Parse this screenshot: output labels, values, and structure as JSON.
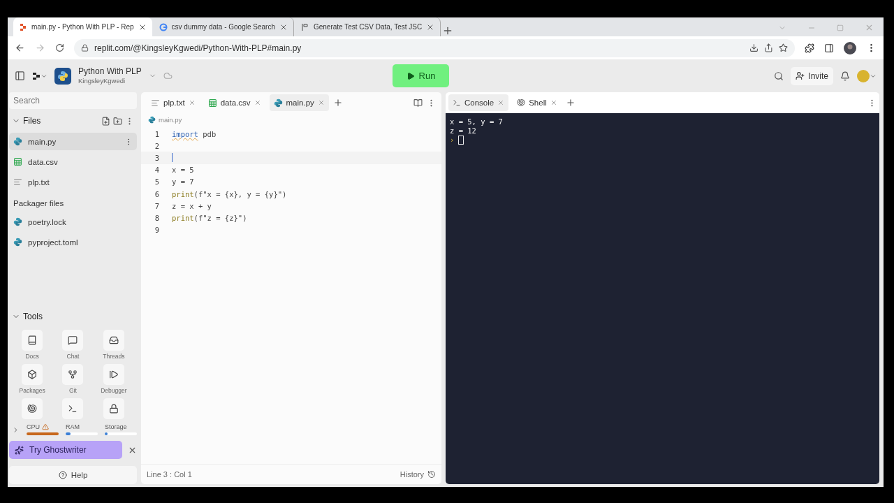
{
  "browser": {
    "tabs": [
      {
        "title": "main.py - Python With PLP - Rep",
        "selected": true
      },
      {
        "title": "csv dummy data - Google Search",
        "selected": false
      },
      {
        "title": "Generate Test CSV Data, Test JSC",
        "selected": false
      }
    ],
    "url": "replit.com/@KingsleyKgwedi/Python-With-PLP#main.py"
  },
  "header": {
    "project": "Python With PLP",
    "owner": "KingsleyKgwedi",
    "run": "Run",
    "invite": "Invite"
  },
  "sidebar": {
    "search": {
      "placeholder": "Search"
    },
    "files_title": "Files",
    "files": [
      {
        "name": "main.py",
        "kind": "python",
        "selected": true
      },
      {
        "name": "data.csv",
        "kind": "spreadsheet",
        "selected": false
      },
      {
        "name": "plp.txt",
        "kind": "text",
        "selected": false
      }
    ],
    "packager_title": "Packager files",
    "packager_files": [
      {
        "name": "poetry.lock",
        "kind": "python",
        "selected": false
      },
      {
        "name": "pyproject.toml",
        "kind": "python",
        "selected": false
      }
    ],
    "tools_title": "Tools",
    "tools": [
      {
        "label": "Docs"
      },
      {
        "label": "Chat"
      },
      {
        "label": "Threads"
      },
      {
        "label": "Packages"
      },
      {
        "label": "Git"
      },
      {
        "label": "Debugger"
      }
    ],
    "meters": [
      {
        "label": "CPU",
        "level": 1,
        "warning": true
      },
      {
        "label": "RAM",
        "level": 0.15,
        "warning": false
      },
      {
        "label": "Storage",
        "level": 0.05,
        "warning": false
      }
    ],
    "ghostwriter": "Try Ghostwriter",
    "help": "Help"
  },
  "editor": {
    "tabs": [
      {
        "title": "plp.txt",
        "kind": "text",
        "selected": false
      },
      {
        "title": "data.csv",
        "kind": "spreadsheet",
        "selected": false
      },
      {
        "title": "main.py",
        "kind": "python",
        "selected": true
      }
    ],
    "breadcrumb": "main.py",
    "lines": [
      {
        "number": "1",
        "tokens": [
          {
            "text": "import",
            "kind": "keyword"
          },
          {
            "text": " pdb",
            "kind": "plain"
          }
        ]
      },
      {
        "number": "2"
      },
      {
        "number": "3",
        "cursor": true
      },
      {
        "number": "4",
        "tokens": [
          {
            "text": "x = 5",
            "kind": "plain"
          }
        ]
      },
      {
        "number": "5",
        "tokens": [
          {
            "text": "y = 7",
            "kind": "plain"
          }
        ]
      },
      {
        "number": "6",
        "tokens": [
          {
            "text": "print",
            "kind": "function"
          },
          {
            "text": "(f\"x = {x}, y = {y}\")",
            "kind": "plain"
          }
        ]
      },
      {
        "number": "7",
        "tokens": [
          {
            "text": "z = x + y",
            "kind": "plain"
          }
        ]
      },
      {
        "number": "8",
        "tokens": [
          {
            "text": "print",
            "kind": "function"
          },
          {
            "text": "(f\"z = {z}\")",
            "kind": "plain"
          }
        ]
      },
      {
        "number": "9"
      }
    ],
    "status": "Line 3 : Col 1",
    "history": "History"
  },
  "console": {
    "tabs": [
      {
        "title": "Console",
        "selected": true
      },
      {
        "title": "Shell",
        "selected": false
      }
    ],
    "output": [
      "x = 5, y = 7",
      "z = 12"
    ],
    "prompt": "›"
  }
}
